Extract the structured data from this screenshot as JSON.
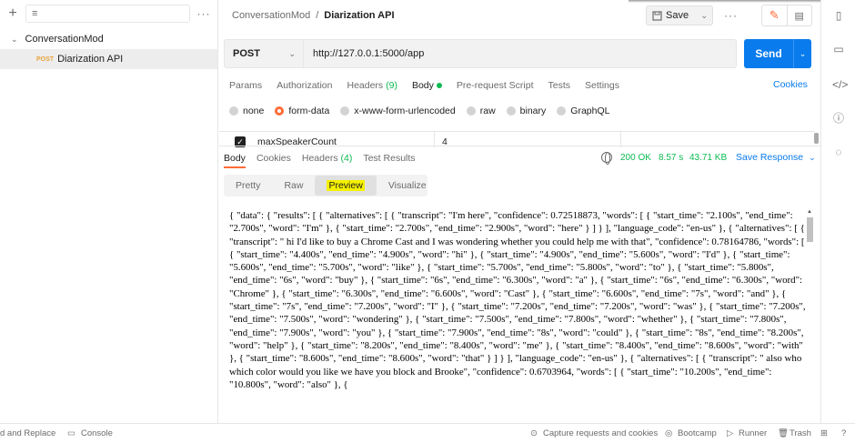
{
  "sidebar": {
    "new_icon": "+",
    "filter_icon": "≡",
    "more_icon": "···",
    "collection": {
      "name": "ConversationMod",
      "chevron": "⌄"
    },
    "request": {
      "method": "POST",
      "name": "Diarization API"
    }
  },
  "header": {
    "collection": "ConversationMod",
    "separator": "/",
    "request": "Diarization API",
    "save_label": "Save",
    "more": "···"
  },
  "url_bar": {
    "method": "POST",
    "url": "http://127.0.0.1:5000/app",
    "send_label": "Send"
  },
  "request_tabs": {
    "params": "Params",
    "authorization": "Authorization",
    "headers": "Headers",
    "headers_count": "(9)",
    "body": "Body",
    "pre_request": "Pre-request Script",
    "tests": "Tests",
    "settings": "Settings",
    "cookies": "Cookies"
  },
  "body_types": {
    "none": "none",
    "form_data": "form-data",
    "urlencoded": "x-www-form-urlencoded",
    "raw": "raw",
    "binary": "binary",
    "graphql": "GraphQL",
    "selected": "form-data"
  },
  "form_row": {
    "checked": true,
    "key": "maxSpeakerCount",
    "value": "4"
  },
  "response": {
    "tabs": {
      "body": "Body",
      "cookies": "Cookies",
      "headers": "Headers",
      "headers_count": "(4)",
      "test_results": "Test Results"
    },
    "status": "200 OK",
    "time": "8.57 s",
    "size": "43.71 KB",
    "save_label": "Save Response",
    "view_tabs": {
      "pretty": "Pretty",
      "raw": "Raw",
      "preview": "Preview",
      "visualize": "Visualize"
    },
    "body_text": "{ \"data\": { \"results\": [ { \"alternatives\": [ { \"transcript\": \"I'm here\", \"confidence\": 0.72518873, \"words\": [ { \"start_time\": \"2.100s\", \"end_time\": \"2.700s\", \"word\": \"I'm\" }, { \"start_time\": \"2.700s\", \"end_time\": \"2.900s\", \"word\": \"here\" } ] } ], \"language_code\": \"en-us\" }, { \"alternatives\": [ { \"transcript\": \" hi I'd like to buy a Chrome Cast and I was wondering whether you could help me with that\", \"confidence\": 0.78164786, \"words\": [ { \"start_time\": \"4.400s\", \"end_time\": \"4.900s\", \"word\": \"hi\" }, { \"start_time\": \"4.900s\", \"end_time\": \"5.600s\", \"word\": \"I'd\" }, { \"start_time\": \"5.600s\", \"end_time\": \"5.700s\", \"word\": \"like\" }, { \"start_time\": \"5.700s\", \"end_time\": \"5.800s\", \"word\": \"to\" }, { \"start_time\": \"5.800s\", \"end_time\": \"6s\", \"word\": \"buy\" }, { \"start_time\": \"6s\", \"end_time\": \"6.300s\", \"word\": \"a\" }, { \"start_time\": \"6s\", \"end_time\": \"6.300s\", \"word\": \"Chrome\" }, { \"start_time\": \"6.300s\", \"end_time\": \"6.600s\", \"word\": \"Cast\" }, { \"start_time\": \"6.600s\", \"end_time\": \"7s\", \"word\": \"and\" }, { \"start_time\": \"7s\", \"end_time\": \"7.200s\", \"word\": \"I\" }, { \"start_time\": \"7.200s\", \"end_time\": \"7.200s\", \"word\": \"was\" }, { \"start_time\": \"7.200s\", \"end_time\": \"7.500s\", \"word\": \"wondering\" }, { \"start_time\": \"7.500s\", \"end_time\": \"7.800s\", \"word\": \"whether\" }, { \"start_time\": \"7.800s\", \"end_time\": \"7.900s\", \"word\": \"you\" }, { \"start_time\": \"7.900s\", \"end_time\": \"8s\", \"word\": \"could\" }, { \"start_time\": \"8s\", \"end_time\": \"8.200s\", \"word\": \"help\" }, { \"start_time\": \"8.200s\", \"end_time\": \"8.400s\", \"word\": \"me\" }, { \"start_time\": \"8.400s\", \"end_time\": \"8.600s\", \"word\": \"with\" }, { \"start_time\": \"8.600s\", \"end_time\": \"8.600s\", \"word\": \"that\" } ] } ], \"language_code\": \"en-us\" }, { \"alternatives\": [ { \"transcript\": \" also who which color would you like we have you block and Brooke\", \"confidence\": 0.6703964, \"words\": [ { \"start_time\": \"10.200s\", \"end_time\": \"10.800s\", \"word\": \"also\" }, {"
  },
  "status_bar": {
    "find_replace": "d and Replace",
    "console": "Console",
    "capture": "Capture requests and cookies",
    "bootcamp": "Bootcamp",
    "runner": "Runner",
    "trash": "Trash"
  },
  "colors": {
    "accent": "#ff6c37",
    "send": "#097bed",
    "success": "#0cbb52",
    "highlight": "#f6f100"
  }
}
